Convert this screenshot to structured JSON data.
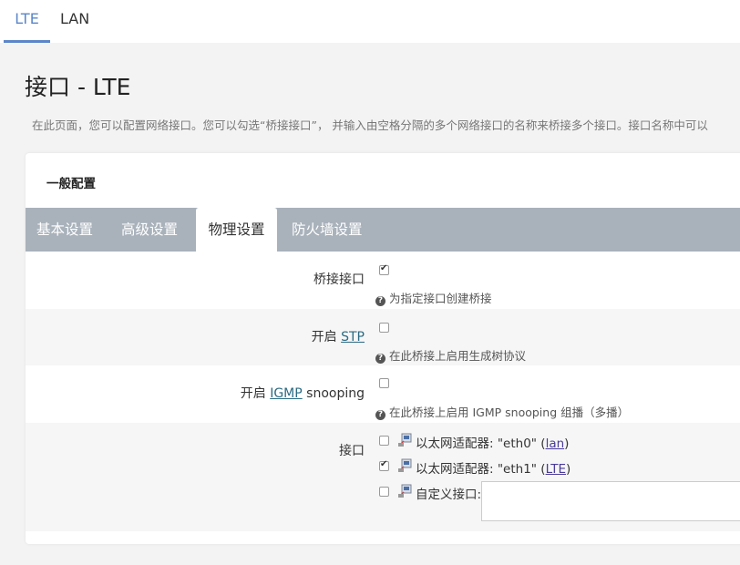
{
  "top_tabs": [
    {
      "label": "LTE",
      "active": true
    },
    {
      "label": "LAN",
      "active": false
    }
  ],
  "page_title": "接口 - LTE",
  "description": "在此页面，您可以配置网络接口。您可以勾选“桥接接口”， 并输入由空格分隔的多个网络接口的名称来桥接多个接口。接口名称中可以",
  "section_title": "一般配置",
  "sub_tabs": [
    {
      "label": "基本设置",
      "active": false
    },
    {
      "label": "高级设置",
      "active": false
    },
    {
      "label": "物理设置",
      "active": true
    },
    {
      "label": "防火墙设置",
      "active": false
    }
  ],
  "fields": {
    "bridge": {
      "label": "桥接接口",
      "checked": true,
      "hint": "为指定接口创建桥接"
    },
    "stp": {
      "label_prefix": "开启 ",
      "label_link": "STP",
      "checked": false,
      "hint": "在此桥接上启用生成树协议"
    },
    "igmp": {
      "label_prefix": "开启 ",
      "label_link": "IGMP",
      "label_suffix": " snooping",
      "checked": false,
      "hint": "在此桥接上启用 IGMP snooping 组播（多播）"
    },
    "interface": {
      "label": "接口",
      "options": [
        {
          "prefix": "以太网适配器: \"eth0\" (",
          "link": "lan",
          "suffix": ")",
          "checked": false
        },
        {
          "prefix": "以太网适配器: \"eth1\" (",
          "link": "LTE",
          "suffix": ")",
          "checked": true
        },
        {
          "prefix": "自定义接口:",
          "link": "",
          "suffix": "",
          "checked": false
        }
      ],
      "custom_value": ""
    }
  },
  "icons": {
    "hint": "question-circle-icon",
    "adapter": "ethernet-adapter-icon"
  }
}
